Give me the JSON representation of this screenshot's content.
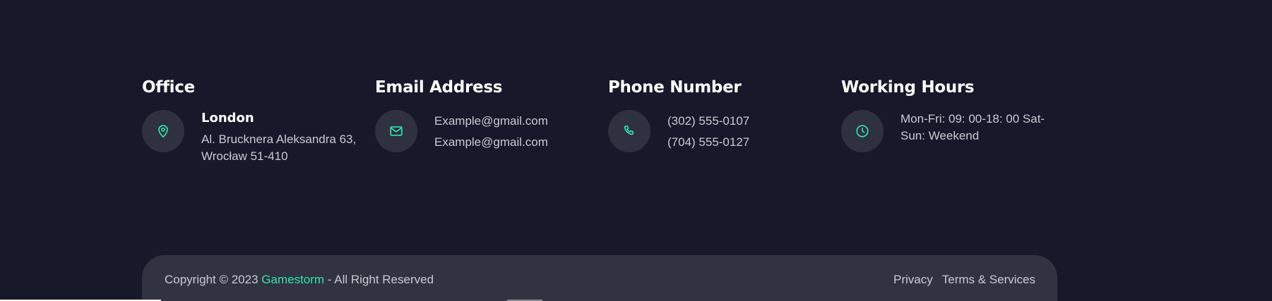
{
  "colors": {
    "background": "#171829",
    "card": "#2f3040",
    "footer_bar": "#323341",
    "accent": "#2fe6ad",
    "text_muted": "#c9cad3",
    "text_white": "#ffffff"
  },
  "contact": {
    "office": {
      "title": "Office",
      "icon": "map-pin-icon",
      "city": "London",
      "address_line1": "Al. Brucknera Aleksandra 63,",
      "address_line2": "Wrocław 51-410"
    },
    "email": {
      "title": "Email Address",
      "icon": "mail-icon",
      "primary": "Example@gmail.com",
      "secondary": "Example@gmail.com"
    },
    "phone": {
      "title": "Phone Number",
      "icon": "phone-icon",
      "primary": "(302) 555-0107",
      "secondary": "(704) 555-0127"
    },
    "hours": {
      "title": "Working Hours",
      "icon": "clock-icon",
      "line1": "Mon-Fri: 09: 00-18: 00 Sat-",
      "line2": "Sun: Weekend"
    }
  },
  "footer": {
    "copyright_prefix": "Copyright © 2023 ",
    "brand": "Gamestorm",
    "copyright_suffix": " - All Right Reserved",
    "links": {
      "privacy": "Privacy",
      "terms": "Terms & Services"
    }
  }
}
